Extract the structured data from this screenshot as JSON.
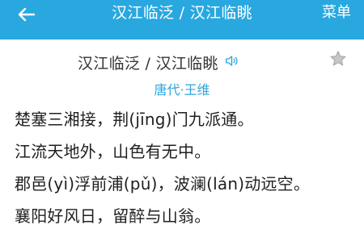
{
  "header": {
    "title": "汉江临泛 / 汉江临眺",
    "menu_label": "菜单",
    "back_icon": "arrow-left-icon"
  },
  "poem": {
    "title": "汉江临泛 / 汉江临眺",
    "author": "唐代·王维",
    "lines": [
      "楚塞三湘接，荆(jīng)门九派通。",
      "江流天地外，山色有无中。",
      "郡邑(yì)浮前浦(pǔ)，波澜(lán)动远空。",
      "襄阳好风日，留醉与山翁。"
    ]
  },
  "colors": {
    "topbar": "#29a8e0",
    "accent": "#2da6dd",
    "text": "#1f1f1f",
    "star": "#c7c7c7"
  },
  "icons": {
    "audio": "speaker-icon",
    "favorite": "star-icon"
  }
}
